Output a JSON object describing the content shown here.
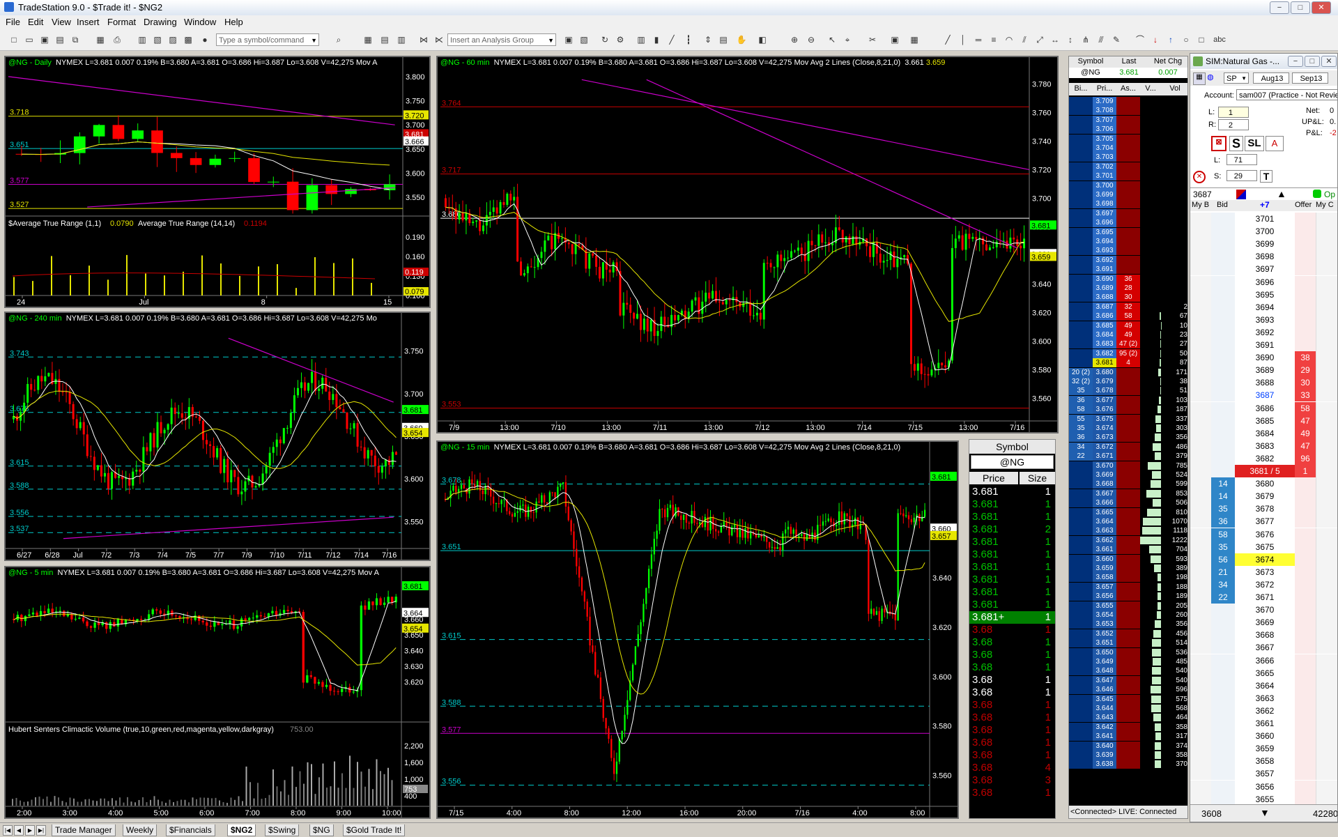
{
  "window": {
    "title": "TradeStation 9.0 - $Trade it! - $NG2",
    "buttons": [
      "−",
      "□",
      "✕"
    ]
  },
  "menu": [
    "File",
    "Edit",
    "View",
    "Insert",
    "Format",
    "Drawing",
    "Window",
    "Help"
  ],
  "toolbar": {
    "symbol_placeholder": "Type a symbol/command",
    "analysis_placeholder": "Insert an Analysis Group"
  },
  "charts": {
    "daily": {
      "symbol": "@NG - Daily",
      "info": "NYMEX  L=3.681  0.007  0.19%  B=3.680  A=3.681  O=3.686  Hi=3.687  Lo=3.608  V=42,275  Mov A",
      "hlines": [
        "3.718",
        "3.651",
        "3.577",
        "3.527"
      ],
      "yticks": [
        "3.800",
        "3.750",
        "3.700",
        "3.650",
        "3.600",
        "3.550"
      ],
      "markers": [
        "3.720",
        "3.681",
        "3.666"
      ],
      "sub_label": "$Average True Range (1,1)",
      "sub_v1": "0.0790",
      "sub_label2": "Average True Range (14,14)",
      "sub_v2": "0.1194",
      "sub_yticks": [
        "0.190",
        "0.160",
        "0.130",
        "0.100"
      ],
      "sub_markers": [
        "0.119",
        "0.079"
      ],
      "xticks": [
        "24",
        "Jul",
        "8",
        "15"
      ]
    },
    "h240": {
      "symbol": "@NG - 240 min",
      "info": "NYMEX  L=3.681  0.007  0.19%  B=3.680  A=3.681  O=3.686  Hi=3.687  Lo=3.608  V=42,275  Mo",
      "hlines": [
        "3.743",
        "3.678",
        "3.615",
        "3.588",
        "3.556",
        "3.537"
      ],
      "yticks": [
        "3.750",
        "3.700",
        "3.650",
        "3.600",
        "3.550"
      ],
      "markers": [
        "3.681",
        "3.660",
        "3.654"
      ],
      "xticks": [
        "6/27",
        "6/28",
        "Jul",
        "7/2",
        "7/3",
        "7/4",
        "7/5",
        "7/7",
        "7/9",
        "7/10",
        "7/11",
        "7/12",
        "7/14",
        "7/16"
      ]
    },
    "m5": {
      "symbol": "@NG - 5 min",
      "info": "NYMEX  L=3.681  0.007  0.19%  B=3.680  A=3.681  O=3.686  Hi=3.687  Lo=3.608  V=42,275  Mov A",
      "yticks": [
        "3.660",
        "3.650",
        "3.640",
        "3.630",
        "3.620"
      ],
      "markers": [
        "3.681",
        "3.664",
        "3.654"
      ],
      "sub_label": "Hubert Senters Climactic Volume (true,10,green,red,magenta,yellow,darkgray)",
      "sub_v": "753.00",
      "sub_yticks": [
        "2,200",
        "1,600",
        "1,000",
        "400"
      ],
      "sub_marker": "753",
      "xticks": [
        "2:00",
        "3:00",
        "4:00",
        "5:00",
        "6:00",
        "7:00",
        "8:00",
        "9:00",
        "10:00"
      ]
    },
    "m60": {
      "symbol": "@NG - 60 min",
      "info": "NYMEX  L=3.681  0.007  0.19%  B=3.680  A=3.681  O=3.686  Hi=3.687  Lo=3.608  V=42,275  Mov Avg 2 Lines (Close,8,21,0)",
      "ma1": "3.661",
      "ma2": "3.659",
      "hlines": [
        "3.764",
        "3.717",
        "3.686",
        "3.553"
      ],
      "yticks": [
        "3.780",
        "3.760",
        "3.740",
        "3.720",
        "3.700",
        "3.680",
        "3.660",
        "3.640",
        "3.620",
        "3.600",
        "3.580",
        "3.560"
      ],
      "markers": [
        "3.681",
        "3.661",
        "3.659"
      ],
      "xticks": [
        "7/9",
        "13:00",
        "7/10",
        "13:00",
        "7/11",
        "13:00",
        "7/12",
        "13:00",
        "7/14",
        "7/15",
        "13:00",
        "7/16"
      ]
    },
    "m15": {
      "symbol": "@NG - 15 min",
      "info": "NYMEX  L=3.681  0.007  0.19%  B=3.680  A=3.681  O=3.686  Hi=3.687  Lo=3.608  V=42,275  Mov Avg 2 Lines (Close,8,21,0)",
      "hlines": [
        "3.678",
        "3.651",
        "3.615",
        "3.588",
        "3.577",
        "3.556"
      ],
      "yticks": [
        "3.660",
        "3.640",
        "3.620",
        "3.600",
        "3.580",
        "3.560"
      ],
      "markers": [
        "3.681",
        "3.660",
        "3.657"
      ],
      "xticks": [
        "7/15",
        "4:00",
        "8:00",
        "12:00",
        "16:00",
        "20:00",
        "7/16",
        "4:00",
        "8:00"
      ]
    }
  },
  "time_sales": {
    "symbol_label": "Symbol",
    "symbol": "@NG",
    "cols": [
      "Price",
      "Size"
    ],
    "rows": [
      {
        "p": "3.681",
        "s": "1",
        "c": "#ffffff"
      },
      {
        "p": "3.681",
        "s": "1",
        "c": "#00c000"
      },
      {
        "p": "3.681",
        "s": "1",
        "c": "#00c000"
      },
      {
        "p": "3.681",
        "s": "2",
        "c": "#00c000"
      },
      {
        "p": "3.681",
        "s": "1",
        "c": "#00c000"
      },
      {
        "p": "3.681",
        "s": "1",
        "c": "#00c000"
      },
      {
        "p": "3.681",
        "s": "1",
        "c": "#00c000"
      },
      {
        "p": "3.681",
        "s": "1",
        "c": "#00c000"
      },
      {
        "p": "3.681",
        "s": "1",
        "c": "#00c000"
      },
      {
        "p": "3.681",
        "s": "1",
        "c": "#00c000"
      },
      {
        "p": "3.681+",
        "s": "1",
        "c": "#ffffff",
        "hl": true
      },
      {
        "p": "3.68",
        "s": "1",
        "c": "#c00000"
      },
      {
        "p": "3.68",
        "s": "1",
        "c": "#00c000"
      },
      {
        "p": "3.68",
        "s": "1",
        "c": "#00c000"
      },
      {
        "p": "3.68",
        "s": "1",
        "c": "#00c000"
      },
      {
        "p": "3.68",
        "s": "1",
        "c": "#ffffff"
      },
      {
        "p": "3.68",
        "s": "1",
        "c": "#ffffff"
      },
      {
        "p": "3.68",
        "s": "1",
        "c": "#c00000"
      },
      {
        "p": "3.68",
        "s": "1",
        "c": "#c00000"
      },
      {
        "p": "3.68",
        "s": "1",
        "c": "#c00000"
      },
      {
        "p": "3.68",
        "s": "1",
        "c": "#c00000"
      },
      {
        "p": "3.68",
        "s": "1",
        "c": "#c00000"
      },
      {
        "p": "3.68",
        "s": "4",
        "c": "#c00000"
      },
      {
        "p": "3.68",
        "s": "3",
        "c": "#c00000"
      },
      {
        "p": "3.68",
        "s": "1",
        "c": "#c00000"
      }
    ]
  },
  "quote": {
    "cols": [
      "Symbol",
      "Last",
      "Net Chg"
    ],
    "row": [
      "@NG",
      "3.681",
      "0.007"
    ],
    "sub_cols": [
      "Bi...",
      "Pri...",
      "As...",
      "V...",
      "Vol"
    ],
    "status": "<Connected> LIVE: Connected",
    "ladder": [
      {
        "p": "3.709",
        "a": "",
        "v": ""
      },
      {
        "p": "3.708",
        "a": "",
        "v": ""
      },
      {
        "p": "3.707",
        "a": "",
        "v": ""
      },
      {
        "p": "3.706",
        "a": "",
        "v": ""
      },
      {
        "p": "3.705",
        "a": "",
        "v": ""
      },
      {
        "p": "3.704",
        "a": "",
        "v": ""
      },
      {
        "p": "3.703",
        "a": "",
        "v": ""
      },
      {
        "p": "3.702",
        "a": "",
        "v": ""
      },
      {
        "p": "3.701",
        "a": "",
        "v": ""
      },
      {
        "p": "3.700",
        "a": "",
        "v": ""
      },
      {
        "p": "3.699",
        "a": "",
        "v": ""
      },
      {
        "p": "3.698",
        "a": "",
        "v": ""
      },
      {
        "p": "3.697",
        "a": "",
        "v": ""
      },
      {
        "p": "3.696",
        "a": "",
        "v": ""
      },
      {
        "p": "3.695",
        "a": "",
        "v": ""
      },
      {
        "p": "3.694",
        "a": "",
        "v": ""
      },
      {
        "p": "3.693",
        "a": "",
        "v": ""
      },
      {
        "p": "3.692",
        "a": "",
        "v": ""
      },
      {
        "p": "3.691",
        "a": "",
        "v": ""
      },
      {
        "p": "3.690",
        "a": "36",
        "v": ""
      },
      {
        "p": "3.689",
        "a": "28",
        "v": ""
      },
      {
        "p": "3.688",
        "a": "30",
        "v": ""
      },
      {
        "p": "3.687",
        "a": "32",
        "v": "2"
      },
      {
        "p": "3.686",
        "a": "58",
        "v": "67"
      },
      {
        "p": "3.685",
        "a": "49",
        "v": "10"
      },
      {
        "p": "3.684",
        "a": "49",
        "v": "23"
      },
      {
        "p": "3.683",
        "a": "47 (2)",
        "v": "27"
      },
      {
        "p": "3.682",
        "a": "95 (2)",
        "v": "50"
      },
      {
        "p": "3.681",
        "a": "4",
        "v": "87"
      },
      {
        "p": "3.680",
        "a": "",
        "v": "171",
        "b": "20 (2)"
      },
      {
        "p": "3.679",
        "a": "",
        "v": "38",
        "b": "32 (2)"
      },
      {
        "p": "3.678",
        "a": "",
        "v": "51",
        "b": "35"
      },
      {
        "p": "3.677",
        "a": "",
        "v": "103",
        "b": "36"
      },
      {
        "p": "3.676",
        "a": "",
        "v": "187",
        "b": "58"
      },
      {
        "p": "3.675",
        "a": "",
        "v": "337",
        "b": "55"
      },
      {
        "p": "3.674",
        "a": "",
        "v": "303",
        "b": "35"
      },
      {
        "p": "3.673",
        "a": "",
        "v": "356",
        "b": "36"
      },
      {
        "p": "3.672",
        "a": "",
        "v": "486",
        "b": "34"
      },
      {
        "p": "3.671",
        "a": "",
        "v": "379",
        "b": "22"
      },
      {
        "p": "3.670",
        "a": "",
        "v": "785"
      },
      {
        "p": "3.669",
        "a": "",
        "v": "524"
      },
      {
        "p": "3.668",
        "a": "",
        "v": "599"
      },
      {
        "p": "3.667",
        "a": "",
        "v": "853"
      },
      {
        "p": "3.666",
        "a": "",
        "v": "506"
      },
      {
        "p": "3.665",
        "a": "",
        "v": "810"
      },
      {
        "p": "3.664",
        "a": "",
        "v": "1070"
      },
      {
        "p": "3.663",
        "a": "",
        "v": "1118"
      },
      {
        "p": "3.662",
        "a": "",
        "v": "1222"
      },
      {
        "p": "3.661",
        "a": "",
        "v": "704"
      },
      {
        "p": "3.660",
        "a": "",
        "v": "593"
      },
      {
        "p": "3.659",
        "a": "",
        "v": "389"
      },
      {
        "p": "3.658",
        "a": "",
        "v": "198"
      },
      {
        "p": "3.657",
        "a": "",
        "v": "188"
      },
      {
        "p": "3.656",
        "a": "",
        "v": "189"
      },
      {
        "p": "3.655",
        "a": "",
        "v": "205"
      },
      {
        "p": "3.654",
        "a": "",
        "v": "260"
      },
      {
        "p": "3.653",
        "a": "",
        "v": "356"
      },
      {
        "p": "3.652",
        "a": "",
        "v": "456"
      },
      {
        "p": "3.651",
        "a": "",
        "v": "514"
      },
      {
        "p": "3.650",
        "a": "",
        "v": "536"
      },
      {
        "p": "3.649",
        "a": "",
        "v": "485"
      },
      {
        "p": "3.648",
        "a": "",
        "v": "540"
      },
      {
        "p": "3.647",
        "a": "",
        "v": "540"
      },
      {
        "p": "3.646",
        "a": "",
        "v": "596"
      },
      {
        "p": "3.645",
        "a": "",
        "v": "575"
      },
      {
        "p": "3.644",
        "a": "",
        "v": "568"
      },
      {
        "p": "3.643",
        "a": "",
        "v": "464"
      },
      {
        "p": "3.642",
        "a": "",
        "v": "358"
      },
      {
        "p": "3.641",
        "a": "",
        "v": "317"
      },
      {
        "p": "3.640",
        "a": "",
        "v": "374"
      },
      {
        "p": "3.639",
        "a": "",
        "v": "358"
      },
      {
        "p": "3.638",
        "a": "",
        "v": "370"
      }
    ]
  },
  "matrix": {
    "title": "SIM:Natural Gas -...",
    "exchange": "SP",
    "month1": "Aug13",
    "month2": "Sep13",
    "account_label": "Account:",
    "account": "sam007 (Practice - Not Revie",
    "net_label": "Net:",
    "net": "0",
    "upl_label": "UP&L:",
    "upl": "0.",
    "pl_label": "P&L:",
    "pl": "-2",
    "l_label": "L:",
    "l_val": "1",
    "r_label": "R:",
    "r_val": "2",
    "l2_val": "71",
    "s_val": "29",
    "qty": "3687",
    "plus": "+7",
    "open": "Op",
    "cols": [
      "My B",
      "Bid",
      "",
      "Offer",
      "My C"
    ],
    "current": "3681 / 5",
    "footer_left": "3608",
    "footer_right": "42280",
    "rows": [
      {
        "p": "3701"
      },
      {
        "p": "3700"
      },
      {
        "p": "3699"
      },
      {
        "p": "3698"
      },
      {
        "p": "3697"
      },
      {
        "p": "3696"
      },
      {
        "p": "3695"
      },
      {
        "p": "3694"
      },
      {
        "p": "3693"
      },
      {
        "p": "3692"
      },
      {
        "p": "3691"
      },
      {
        "p": "3690",
        "o": "38"
      },
      {
        "p": "3689",
        "o": "29"
      },
      {
        "p": "3688",
        "o": "30"
      },
      {
        "p": "3687",
        "o": "33",
        "hl": "blue"
      },
      {
        "p": "3686",
        "o": "58"
      },
      {
        "p": "3685",
        "o": "47"
      },
      {
        "p": "3684",
        "o": "49"
      },
      {
        "p": "3683",
        "o": "47"
      },
      {
        "p": "3682",
        "o": "96"
      },
      {
        "p": "3681 / 5",
        "o": "1",
        "cur": true
      },
      {
        "p": "3680",
        "b": "14"
      },
      {
        "p": "3679",
        "b": "14"
      },
      {
        "p": "3678",
        "b": "35"
      },
      {
        "p": "3677",
        "b": "36"
      },
      {
        "p": "3676",
        "b": "58"
      },
      {
        "p": "3675",
        "b": "35"
      },
      {
        "p": "3674",
        "b": "56",
        "hl": "yellow"
      },
      {
        "p": "3673",
        "b": "21"
      },
      {
        "p": "3672",
        "b": "34"
      },
      {
        "p": "3671",
        "b": "22"
      },
      {
        "p": "3670"
      },
      {
        "p": "3669"
      },
      {
        "p": "3668"
      },
      {
        "p": "3667"
      },
      {
        "p": "3666"
      },
      {
        "p": "3665"
      },
      {
        "p": "3664"
      },
      {
        "p": "3663"
      },
      {
        "p": "3662"
      },
      {
        "p": "3661"
      },
      {
        "p": "3660"
      },
      {
        "p": "3659"
      },
      {
        "p": "3658"
      },
      {
        "p": "3657"
      },
      {
        "p": "3656"
      },
      {
        "p": "3655"
      }
    ]
  },
  "tabs": [
    "Trade Manager",
    "Weekly",
    "$Financials",
    "$NG2",
    "$Swing",
    "$NG",
    "$Gold Trade It!"
  ],
  "colors": {
    "up": "#00ff00",
    "down": "#ff0000",
    "ma_fast": "#ffffff",
    "ma_slow": "#e6e600",
    "trend": "#cc00cc",
    "hline_cyan": "#00cccc"
  }
}
